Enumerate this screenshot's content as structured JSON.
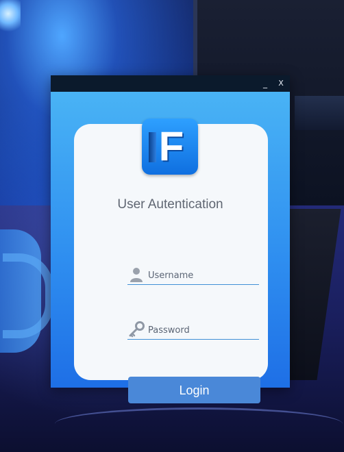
{
  "window": {
    "minimize_label": "_",
    "close_label": "X"
  },
  "logo": {
    "letter": "F"
  },
  "heading": "User Autentication",
  "username": {
    "placeholder": "Username",
    "icon": "user-icon"
  },
  "password": {
    "placeholder": "Password",
    "icon": "key-icon"
  },
  "login_label": "Login",
  "colors": {
    "titlebar": "#0b1a2c",
    "window_gradient_top": "#49b3f5",
    "window_gradient_bottom": "#1e6fe6",
    "card": "#f5f8fb",
    "accent": "#4a88d8",
    "field_underline": "#3f8fd6",
    "heading_text": "#5f6672"
  }
}
